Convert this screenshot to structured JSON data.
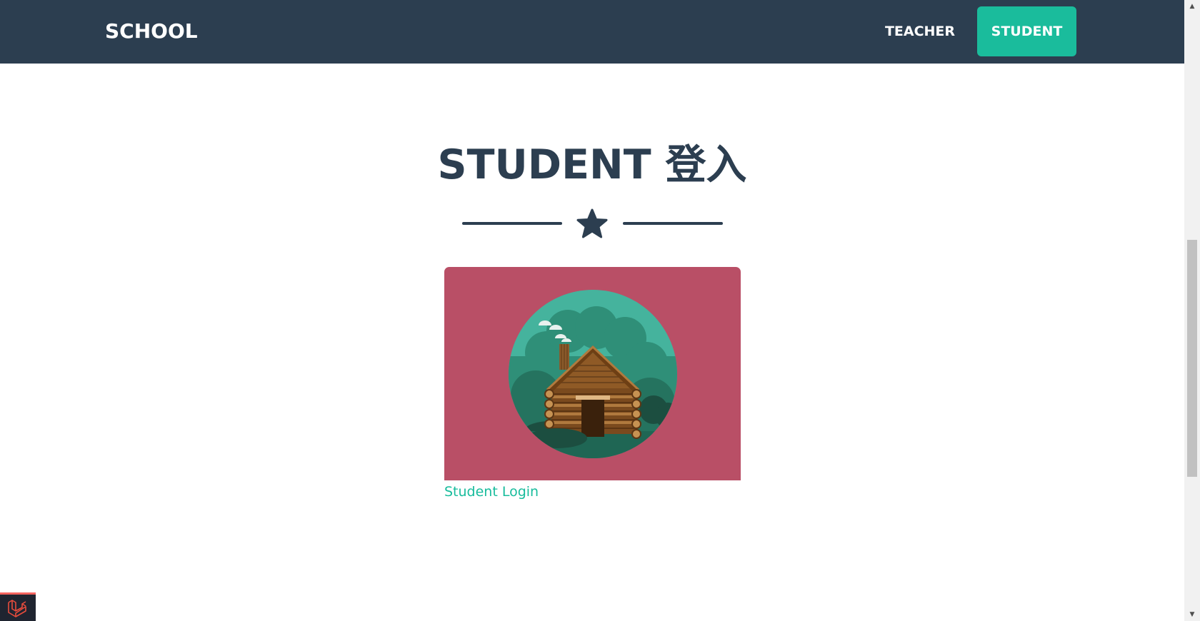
{
  "navbar": {
    "brand": "SCHOOL",
    "links": [
      {
        "label": "TEACHER",
        "active": false
      },
      {
        "label": "STUDENT",
        "active": true
      }
    ]
  },
  "main": {
    "heading": "STUDENT 登入",
    "divider_icon": "star-icon",
    "card": {
      "image": "log-cabin-illustration",
      "link_label": "Student Login"
    }
  },
  "colors": {
    "navbar_bg": "#2c3e50",
    "accent": "#1abc9c",
    "card_bg": "#b94f66",
    "heading": "#2c3e50"
  },
  "debugbar": {
    "icon": "laravel-icon"
  }
}
